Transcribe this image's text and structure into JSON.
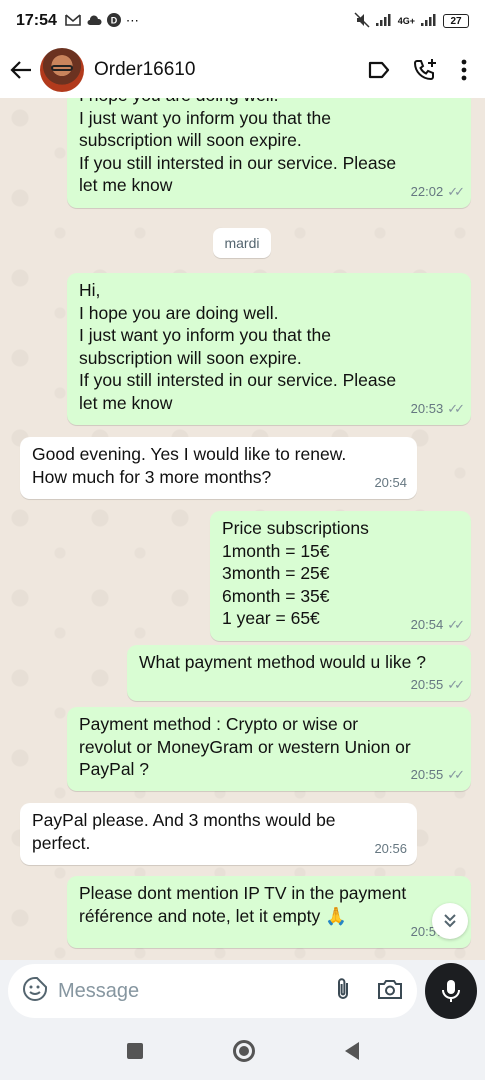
{
  "status_bar": {
    "time": "17:54",
    "left_icons": [
      "gmail-icon",
      "cloud-icon",
      "d-app-icon",
      "more-dots"
    ],
    "network": "4G+",
    "battery": "27"
  },
  "header": {
    "contact_name": "Order16610"
  },
  "date_separator": "mardi",
  "messages": [
    {
      "direction": "out",
      "text": "I hope you are doing well.\nI just want yo inform you that the\nsubscription will soon expire.\nIf you still intersted in our service. Please\nlet me know",
      "time": "22:02",
      "ticks": "✓✓"
    },
    {
      "direction": "out",
      "text": "Hi,\nI hope you are doing well.\nI just want yo inform you that the\nsubscription will soon expire.\nIf you still intersted in our service. Please\nlet me know",
      "time": "20:53",
      "ticks": "✓✓"
    },
    {
      "direction": "in",
      "text": "Good evening. Yes I would like to renew.\nHow much for 3 more months?",
      "time": "20:54"
    },
    {
      "direction": "out",
      "text": "Price subscriptions\n1month = 15€\n3month = 25€\n6month = 35€\n1 year = 65€",
      "time": "20:54",
      "ticks": "✓✓"
    },
    {
      "direction": "out",
      "text": "What payment method would u like ?",
      "time": "20:55",
      "ticks": "✓✓"
    },
    {
      "direction": "out",
      "text": "Payment method : Crypto or wise or\nrevolut or MoneyGram or western Union or\nPayPal ?",
      "time": "20:55",
      "ticks": "✓✓"
    },
    {
      "direction": "in",
      "text": "PayPal please. And 3 months would be\nperfect.",
      "time": "20:56"
    },
    {
      "direction": "out",
      "text": "Please dont mention IP TV in the payment\nréférence and note, let it empty 🙏",
      "time": "20:57",
      "ticks": "✓✓"
    }
  ],
  "composer": {
    "placeholder": "Message"
  },
  "colors": {
    "outgoing_bubble": "#d9fdd3",
    "incoming_bubble": "#ffffff",
    "chat_background": "#efe7de",
    "mic_button": "#1c1e21"
  }
}
